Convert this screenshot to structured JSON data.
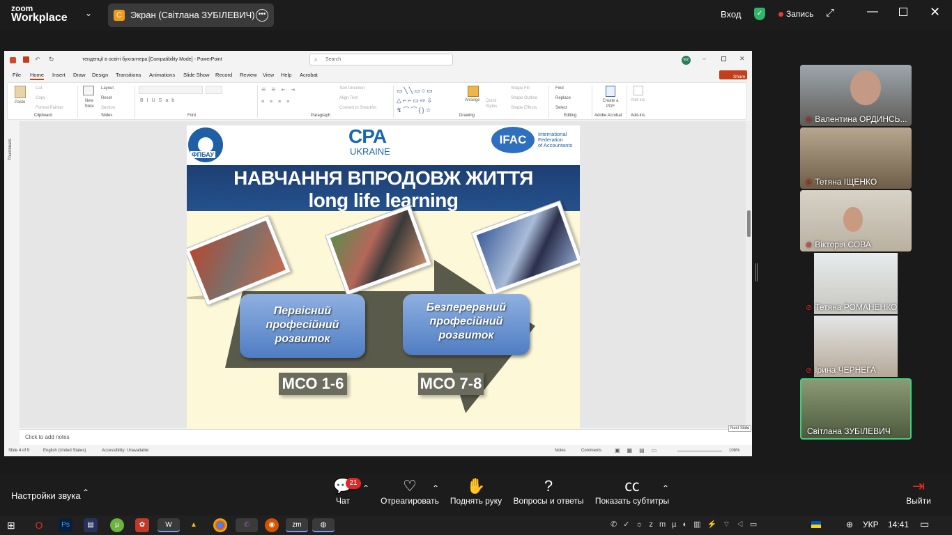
{
  "zoom": {
    "logo_line1": "zoom",
    "logo_line2": "Workplace",
    "share_badge": "C",
    "share_label": "Экран (Світлана ЗУБІЛЕВИЧ)",
    "signin": "Вход",
    "record": "Запись"
  },
  "ppt": {
    "window_title": "тенденції в освіті бухгалтера [Compatibility Mode] - PowerPoint",
    "search_placeholder": "Search",
    "avatar": "MZ",
    "share_btn": "Share",
    "menu": [
      "File",
      "Home",
      "Insert",
      "Draw",
      "Design",
      "Transitions",
      "Animations",
      "Slide Show",
      "Record",
      "Review",
      "View",
      "Help",
      "Acrobat"
    ],
    "ribbon": {
      "paste": "Paste",
      "cut": "Cut",
      "copy": "Copy",
      "format_painter": "Format Painter",
      "new_slide": "New Slide",
      "layout": "Layout",
      "reset": "Reset",
      "section": "Section",
      "text_direction": "Text Direction",
      "align_text": "Align Text",
      "convert_smartart": "Convert to SmartArt",
      "arrange": "Arrange",
      "quick_styles": "Quick Styles",
      "shape_fill": "Shape Fill",
      "shape_outline": "Shape Outline",
      "shape_effects": "Shape Effects",
      "find": "Find",
      "replace": "Replace",
      "select": "Select",
      "create_pdf": "Create a PDF",
      "addins": "Add-ins",
      "groups": [
        "Clipboard",
        "Slides",
        "Font",
        "Paragraph",
        "Drawing",
        "Editing",
        "Adobe Acrobat",
        "Add-ins"
      ]
    },
    "thumbnails_label": "Thumbnails",
    "slide": {
      "logo_left_text": "ФПБАУ",
      "cpa": "CPA",
      "cpa_sub": "UKRAINE",
      "ifac": "IFAC",
      "ifac_line1": "International",
      "ifac_line2": "Federation",
      "ifac_line3": "of Accountants",
      "title1": "НАВЧАННЯ ВПРОДОВЖ ЖИТТЯ",
      "title2": "long life learning",
      "box1": "Первісний професійний розвиток",
      "box2": "Безперервний професійний розвиток",
      "mco1": "МСО 1-6",
      "mco2": "МСО 7-8"
    },
    "notes_placeholder": "Click to add notes",
    "next_slide_tip": "Next Slide",
    "status": {
      "slide": "Slide 4 of 9",
      "lang": "English (United States)",
      "accessibility": "Accessibility: Unavailable",
      "notes": "Notes",
      "comments": "Comments",
      "zoom": "106%"
    }
  },
  "participants": [
    {
      "name": "Валентина ОРДИНСЬ..."
    },
    {
      "name": "Тетяна ІЩЕНКО"
    },
    {
      "name": "Вікторія СОВА"
    },
    {
      "name": "Тетяна РОМАНЕНКО"
    },
    {
      "name": "Ірина ЧЕРНЕГА"
    },
    {
      "name": "Світлана ЗУБІЛЕВИЧ"
    }
  ],
  "bottom": {
    "audio": "Настройки звука",
    "chat": "Чат",
    "chat_count": "21",
    "react": "Отреагировать",
    "raise": "Поднять руку",
    "qa": "Вопросы и ответы",
    "cc": "Показать субтитры",
    "leave": "Выйти"
  },
  "taskbar": {
    "lang": "УКР",
    "time": "14:41"
  },
  "colors": {
    "title_band": "#1d3f73",
    "slide_bg": "#fcf8d8",
    "active_speaker": "#3fd07a",
    "chat_badge": "#e02828"
  }
}
